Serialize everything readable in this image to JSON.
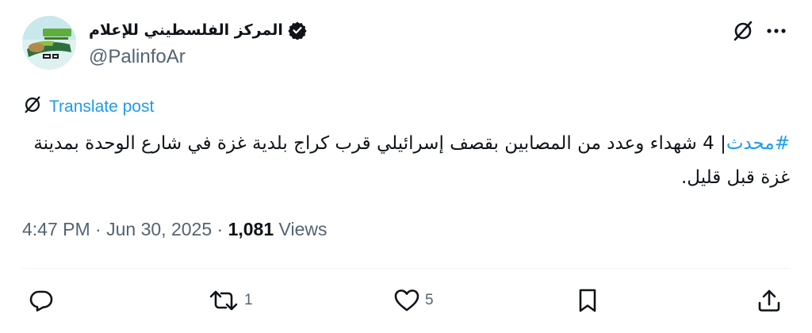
{
  "author": {
    "display_name": "المركز الفلسطيني للإعلام",
    "handle": "@PalinfoAr",
    "verified": true,
    "avatar_icon": "palinfo-logo"
  },
  "translate": {
    "label": "Translate post",
    "icon": "translate-icon"
  },
  "tweet": {
    "hashtag": "#محدث",
    "text": "| 4 شهداء وعدد من المصابين بقصف إسرائيلي قرب كراج بلدية غزة في شارع الوحدة بمدينة غزة قبل قليل."
  },
  "meta": {
    "time": "4:47 PM",
    "separator": "·",
    "date": "Jun 30, 2025",
    "views_count": "1,081",
    "views_label": "Views"
  },
  "actions": {
    "reply_count": "",
    "retweet_count": "1",
    "like_count": "5"
  },
  "colors": {
    "accent": "#1d9bf0",
    "text": "#0f1419",
    "muted": "#536471",
    "divider": "#eff3f4"
  }
}
